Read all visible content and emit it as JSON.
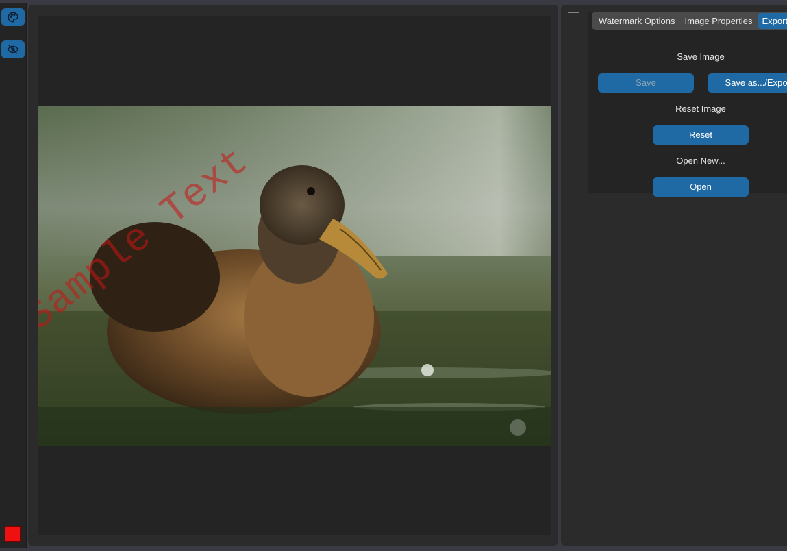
{
  "sidebar": {
    "buttons": [
      {
        "icon": "palette-icon"
      },
      {
        "icon": "eye-slash-icon"
      }
    ],
    "color_swatch": "#ee1111"
  },
  "canvas": {
    "watermark_text": "Sample Text",
    "watermark_color": "#c81414"
  },
  "panel": {
    "collapse_label": "—",
    "tabs": [
      {
        "label": "Watermark Options",
        "active": false
      },
      {
        "label": "Image Properties",
        "active": false
      },
      {
        "label": "Export/",
        "active": true
      }
    ],
    "save_section": {
      "title": "Save Image",
      "save_label": "Save",
      "save_as_label": "Save as.../Export"
    },
    "reset_section": {
      "title": "Reset Image",
      "reset_label": "Reset"
    },
    "open_section": {
      "title": "Open New...",
      "open_label": "Open"
    }
  },
  "colors": {
    "accent": "#1f6aa5",
    "background": "#242424"
  }
}
